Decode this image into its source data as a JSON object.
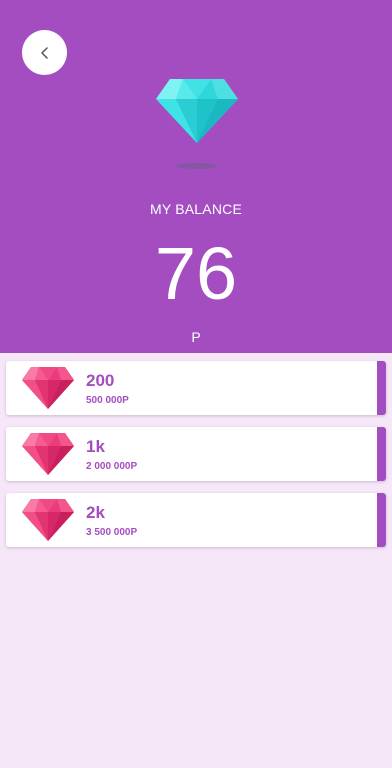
{
  "header": {
    "back_icon": "chevron-left-icon",
    "hero_icon": "diamond-icon",
    "balance_label": "MY BALANCE",
    "balance_value": "76",
    "balance_unit": "P"
  },
  "offers": [
    {
      "amount": "200",
      "price": "500 000P",
      "icon": "pink-diamond-icon"
    },
    {
      "amount": "1k",
      "price": "2 000 000P",
      "icon": "pink-diamond-icon"
    },
    {
      "amount": "2k",
      "price": "3 500 000P",
      "icon": "pink-diamond-icon"
    }
  ],
  "colors": {
    "primary": "#a44dc1",
    "background": "#f5e6f8",
    "hero_gem": "#3ee0e3",
    "offer_gem": "#f0407f"
  }
}
